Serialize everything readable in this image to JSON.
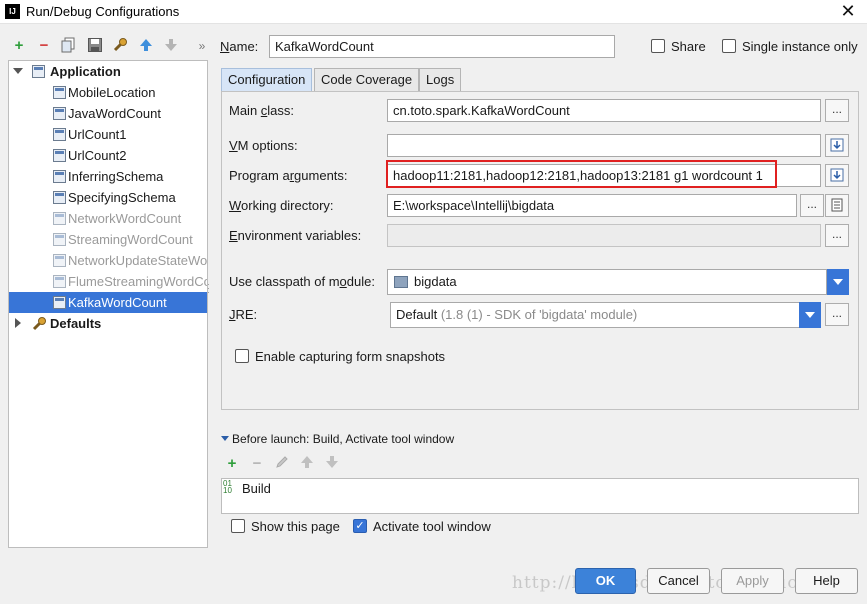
{
  "window": {
    "title": "Run/Debug Configurations",
    "app_icon": "IJ"
  },
  "toolbar": {
    "icons": [
      "add-icon",
      "remove-icon",
      "copy-icon",
      "save-icon",
      "wrench-icon",
      "move-up-icon",
      "move-down-icon",
      "more-icon"
    ]
  },
  "tree": {
    "application_label": "Application",
    "items": [
      {
        "label": "MobileLocation",
        "dim": false
      },
      {
        "label": "JavaWordCount",
        "dim": false
      },
      {
        "label": "UrlCount1",
        "dim": false
      },
      {
        "label": "UrlCount2",
        "dim": false
      },
      {
        "label": "InferringSchema",
        "dim": false
      },
      {
        "label": "SpecifyingSchema",
        "dim": false
      },
      {
        "label": "NetworkWordCount",
        "dim": true
      },
      {
        "label": "StreamingWordCount",
        "dim": true
      },
      {
        "label": "NetworkUpdateStateWordCount",
        "dim": true
      },
      {
        "label": "FlumeStreamingWordCount",
        "dim": true
      },
      {
        "label": "KafkaWordCount",
        "dim": false,
        "selected": true
      }
    ],
    "defaults_label": "Defaults"
  },
  "form": {
    "name_label": "Name:",
    "name_value": "KafkaWordCount",
    "share_label": "Share",
    "single_instance_label": "Single instance only",
    "tabs": [
      "Configuration",
      "Code Coverage",
      "Logs"
    ],
    "main_class_label": "Main class:",
    "main_class_value": "cn.toto.spark.KafkaWordCount",
    "vm_options_label": "VM options:",
    "vm_options_value": "",
    "program_arguments_label": "Program arguments:",
    "program_arguments_value": "hadoop11:2181,hadoop12:2181,hadoop13:2181 g1 wordcount 1",
    "working_directory_label": "Working directory:",
    "working_directory_value": "E:\\workspace\\Intellij\\bigdata",
    "env_vars_label": "Environment variables:",
    "env_vars_value": "",
    "classpath_label": "Use classpath of module:",
    "classpath_value": "bigdata",
    "jre_label": "JRE:",
    "jre_value_main": "Default",
    "jre_value_detail": " (1.8 (1) - SDK of 'bigdata' module)",
    "snapshots_label": "Enable capturing form snapshots",
    "ellipsis": "...",
    "before_launch_label": "Before launch: Build, Activate tool window",
    "build_item": "Build",
    "show_page_label": "Show this page",
    "activate_tool_label": "Activate tool window"
  },
  "buttons": {
    "ok": "OK",
    "cancel": "Cancel",
    "apply": "Apply",
    "help": "Help"
  },
  "watermark": "http://blog.csdn.net/tototuzuoquan",
  "colors": {
    "selection": "#3875d7",
    "highlight_box": "#e02020",
    "add_green": "#2e9e3b",
    "remove_red": "#d23a3a"
  }
}
